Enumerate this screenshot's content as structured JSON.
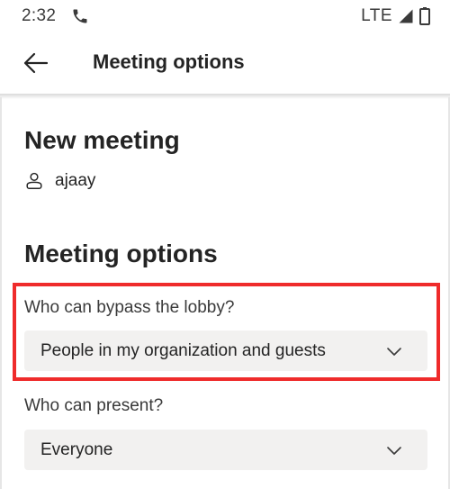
{
  "status_bar": {
    "time": "2:32",
    "network": "LTE",
    "icons": [
      "phone-icon",
      "signal-icon",
      "battery-icon"
    ]
  },
  "app_bar": {
    "title": "Meeting options",
    "back_icon": "arrow-left-icon"
  },
  "meeting": {
    "title": "New meeting",
    "organizer": "ajaay",
    "organizer_icon": "person-icon"
  },
  "options": {
    "heading": "Meeting options",
    "lobby": {
      "label": "Who can bypass the lobby?",
      "value": "People in my organization and guests"
    },
    "present": {
      "label": "Who can present?",
      "value": "Everyone"
    }
  },
  "colors": {
    "highlight": "#ef2b2b",
    "dropdown_bg": "#f2f1f0",
    "text": "#242424"
  }
}
